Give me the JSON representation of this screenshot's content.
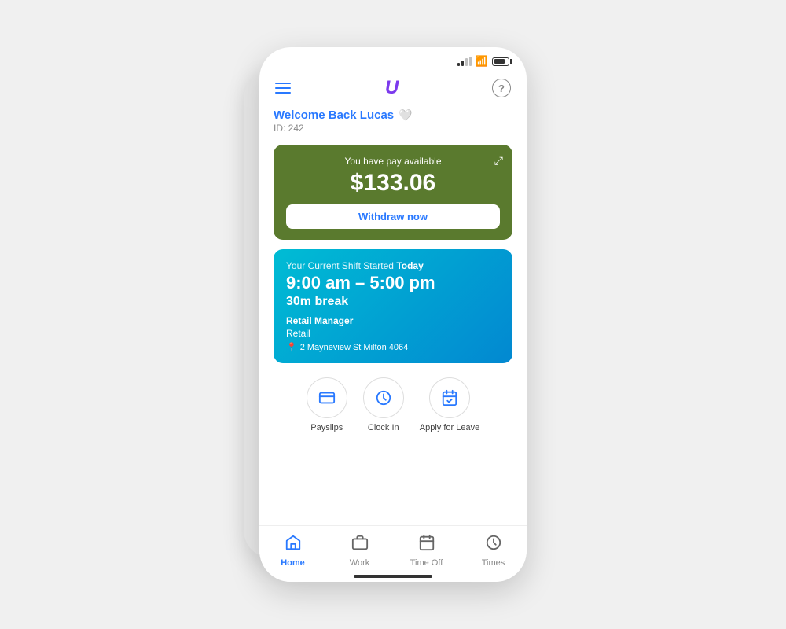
{
  "statusBar": {
    "wifi": "📶",
    "batteryLevel": "80"
  },
  "header": {
    "logoText": "U",
    "helpLabel": "?"
  },
  "welcome": {
    "text": "Welcome Back Lucas",
    "heartSymbol": "🤍",
    "idLabel": "ID: 242"
  },
  "payCard": {
    "title": "You have pay available",
    "amount": "$133.06",
    "withdrawBtn": "Withdraw now"
  },
  "shiftCard": {
    "startedLabel": "Your Current Shift Started",
    "todayLabel": "Today",
    "timeRange": "9:00 am – 5:00 pm",
    "breakInfo": "30m break",
    "role": "Retail Manager",
    "department": "Retail",
    "location": "2 Mayneview St Milton 4064"
  },
  "actions": [
    {
      "id": "payslips",
      "icon": "💳",
      "label": "Payslips"
    },
    {
      "id": "clockin",
      "icon": "⏰",
      "label": "Clock In"
    },
    {
      "id": "applyleave",
      "icon": "📅",
      "label": "Apply for Leave"
    }
  ],
  "bottomNav": [
    {
      "id": "home",
      "icon": "🏠",
      "label": "Home",
      "active": true
    },
    {
      "id": "work",
      "icon": "💼",
      "label": "Work",
      "active": false
    },
    {
      "id": "timeoff",
      "icon": "📋",
      "label": "Time Off",
      "active": false
    },
    {
      "id": "times",
      "icon": "🕐",
      "label": "Times",
      "active": false
    }
  ]
}
